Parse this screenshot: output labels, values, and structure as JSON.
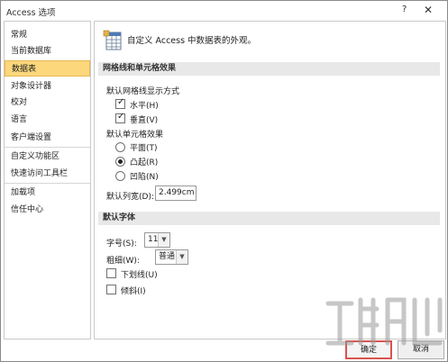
{
  "window": {
    "title": "Access 选项",
    "help_label": "?",
    "close_label": "✕"
  },
  "sidebar": {
    "items": [
      {
        "label": "常规",
        "selected": false
      },
      {
        "label": "当前数据库",
        "selected": false
      },
      {
        "label": "数据表",
        "selected": true
      },
      {
        "label": "对象设计器",
        "selected": false
      },
      {
        "label": "校对",
        "selected": false
      },
      {
        "label": "语言",
        "selected": false
      },
      {
        "label": "客户端设置",
        "selected": false
      },
      {
        "label": "自定义功能区",
        "selected": false
      },
      {
        "label": "快速访问工具栏",
        "selected": false
      },
      {
        "label": "加载项",
        "selected": false
      },
      {
        "label": "信任中心",
        "selected": false
      }
    ]
  },
  "main": {
    "header_text": "自定义 Access 中数据表的外观。",
    "grid_section": {
      "title": "网格线和单元格效果",
      "gridlines_label": "默认网格线显示方式",
      "horizontal": {
        "label": "水平(H)",
        "checked": true
      },
      "vertical": {
        "label": "垂直(V)",
        "checked": true
      },
      "cell_effect_label": "默认单元格效果",
      "effects": [
        {
          "label": "平面(T)",
          "selected": false
        },
        {
          "label": "凸起(R)",
          "selected": true
        },
        {
          "label": "凹陷(N)",
          "selected": false
        }
      ],
      "column_width_label": "默认列宽(D):",
      "column_width_value": "2.499cm"
    },
    "font_section": {
      "title": "默认字体",
      "size_label": "字号(S):",
      "size_value": "11",
      "weight_label": "粗细(W):",
      "weight_value": "普通",
      "underline": {
        "label": "下划线(U)",
        "checked": false
      },
      "italic": {
        "label": "倾斜(I)",
        "checked": false
      }
    }
  },
  "footer": {
    "ok_label": "确定",
    "cancel_label": "取消"
  },
  "colors": {
    "selected_bg": "#fcd77c",
    "section_bg": "#e8e8e8",
    "ok_border": "#d9534f"
  }
}
